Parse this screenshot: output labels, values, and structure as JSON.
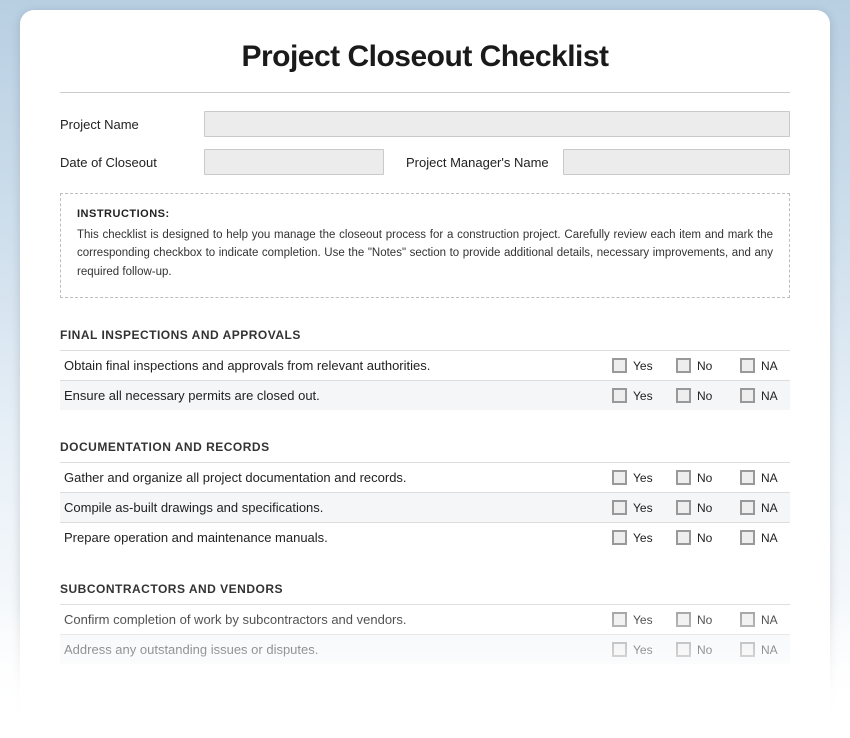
{
  "title": "Project Closeout Checklist",
  "fields": {
    "project_name": {
      "label": "Project Name",
      "value": ""
    },
    "date_of_closeout": {
      "label": "Date of Closeout",
      "value": ""
    },
    "pm_name": {
      "label": "Project Manager's Name",
      "value": ""
    }
  },
  "instructions": {
    "heading": "INSTRUCTIONS:",
    "body": "This checklist is designed to help you manage the closeout process for a construction project. Carefully review each item and mark the corresponding checkbox to indicate completion. Use the \"Notes\" section to provide additional details, necessary improvements, and any required follow-up."
  },
  "options": {
    "yes": "Yes",
    "no": "No",
    "na": "NA"
  },
  "sections": [
    {
      "heading": "FINAL INSPECTIONS AND APPROVALS",
      "items": [
        "Obtain final inspections and approvals from relevant authorities.",
        "Ensure all necessary permits are closed out."
      ]
    },
    {
      "heading": "DOCUMENTATION AND RECORDS",
      "items": [
        "Gather and organize all project documentation and records.",
        "Compile as-built drawings and specifications.",
        "Prepare operation and maintenance manuals."
      ]
    },
    {
      "heading": "SUBCONTRACTORS AND VENDORS",
      "items": [
        "Confirm completion of work by subcontractors and vendors.",
        "Address any outstanding issues or disputes."
      ]
    }
  ]
}
